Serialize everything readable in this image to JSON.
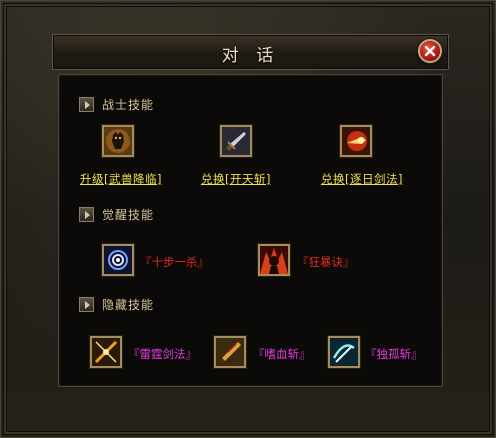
{
  "dialog": {
    "title": "对 话",
    "close_icon": "close-icon"
  },
  "sections": [
    {
      "label": "战士技能",
      "items": [
        {
          "icon": "warrior-beast-icon",
          "label": "升级[武兽降临]"
        },
        {
          "icon": "sword-icon",
          "label": "兑换[开天斩]"
        },
        {
          "icon": "fire-slash-icon",
          "label": "兑换[逐日剑法]"
        }
      ]
    },
    {
      "label": "觉醒技能",
      "items": [
        {
          "icon": "vortex-icon",
          "label": "『十步一杀』"
        },
        {
          "icon": "rage-warrior-icon",
          "label": "『狂暴诀』"
        }
      ]
    },
    {
      "label": "隐藏技能",
      "items": [
        {
          "icon": "thunder-sword-icon",
          "label": "『雷霆剑法』"
        },
        {
          "icon": "blood-blade-icon",
          "label": "『嗜血斩』"
        },
        {
          "icon": "solitary-slash-icon",
          "label": "『独孤斩』"
        }
      ]
    }
  ],
  "colors": {
    "link": "#f2e34b",
    "awaken": "#e02a22",
    "hidden": "#e33ce0",
    "section": "#d9c49a"
  }
}
